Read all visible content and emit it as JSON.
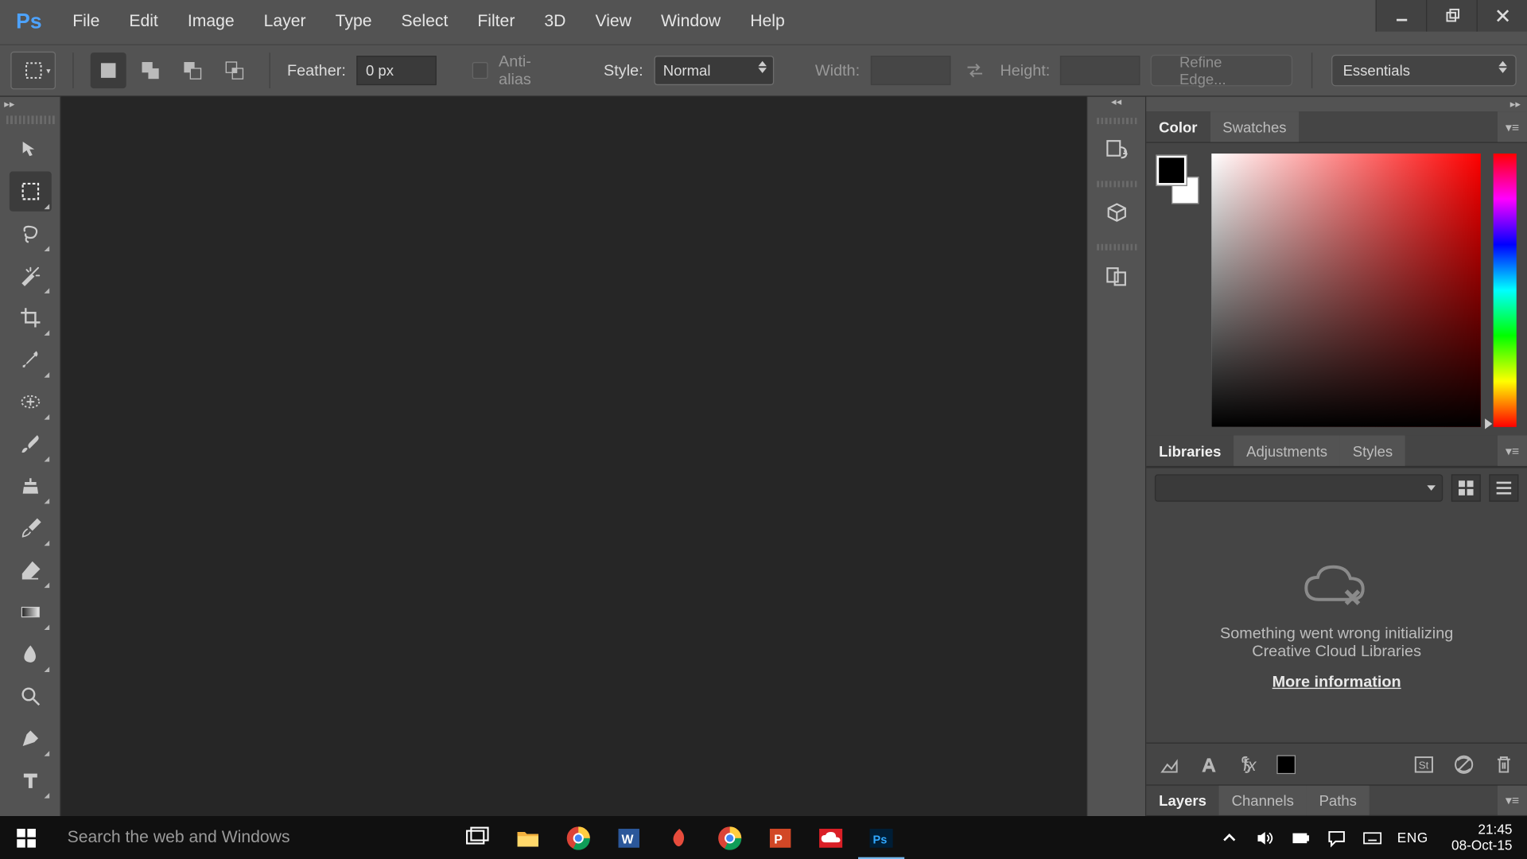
{
  "menu": [
    "File",
    "Edit",
    "Image",
    "Layer",
    "Type",
    "Select",
    "Filter",
    "3D",
    "View",
    "Window",
    "Help"
  ],
  "options": {
    "feather_label": "Feather:",
    "feather_value": "0 px",
    "antialias_label": "Anti-alias",
    "style_label": "Style:",
    "style_value": "Normal",
    "width_label": "Width:",
    "height_label": "Height:",
    "refine_label": "Refine Edge...",
    "workspace": "Essentials"
  },
  "panels": {
    "color_tabs": [
      "Color",
      "Swatches"
    ],
    "lib_tabs": [
      "Libraries",
      "Adjustments",
      "Styles"
    ],
    "layer_tabs": [
      "Layers",
      "Channels",
      "Paths"
    ],
    "lib_error1": "Something went wrong initializing",
    "lib_error2": "Creative Cloud Libraries",
    "more_info": "More information"
  },
  "taskbar": {
    "search_placeholder": "Search the web and Windows",
    "lang": "ENG",
    "time": "21:45",
    "date": "08-Oct-15"
  },
  "tools": [
    "move",
    "marquee",
    "lasso",
    "wand",
    "crop",
    "eyedropper",
    "healing",
    "brush",
    "stamp",
    "history-brush",
    "eraser",
    "gradient",
    "blur",
    "zoom",
    "pen",
    "type"
  ],
  "dock": [
    "history",
    "3d",
    "materials"
  ]
}
